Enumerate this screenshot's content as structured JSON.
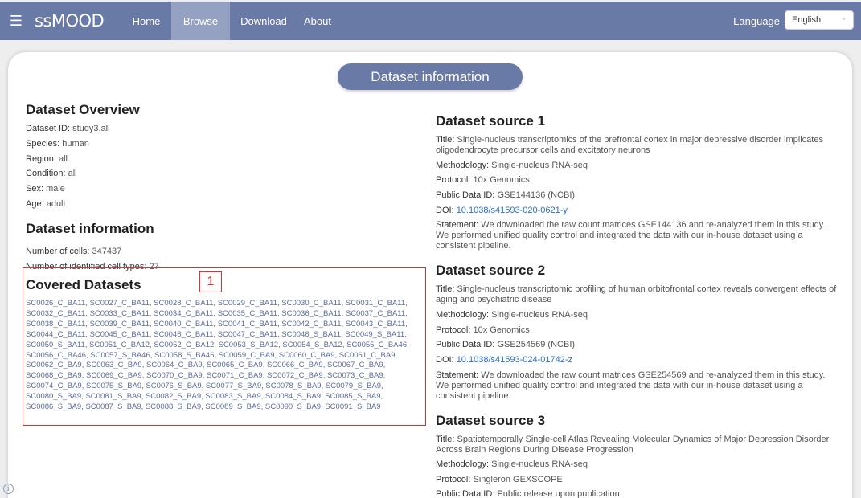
{
  "navbar": {
    "menu_icon": "hamburger-menu-icon",
    "logo": "ssMOOD",
    "items": [
      {
        "label": "Home",
        "active": false
      },
      {
        "label": "Browse",
        "active": true
      },
      {
        "label": "Download",
        "active": false
      },
      {
        "label": "About",
        "active": false
      }
    ],
    "language_label": "Language",
    "language_selected": "English"
  },
  "header": {
    "title": "Dataset information"
  },
  "overview": {
    "title": "Dataset Overview",
    "fields": [
      {
        "label": "Dataset ID:",
        "value": "study3.all"
      },
      {
        "label": "Species:",
        "value": "human"
      },
      {
        "label": "Region:",
        "value": "all"
      },
      {
        "label": "Condition:",
        "value": "all"
      },
      {
        "label": "Sex:",
        "value": "male"
      },
      {
        "label": "Age:",
        "value": "adult"
      }
    ]
  },
  "info": {
    "title": "Dataset information",
    "fields": [
      {
        "label": "Number of cells:",
        "value": "347437"
      },
      {
        "label": "Number of identified cell types:",
        "value": "27"
      }
    ]
  },
  "covered": {
    "title": "Covered Datasets",
    "annotation_tag": "1",
    "lines": [
      "SC0026_C_BA11, SC0027_C_BA11, SC0028_C_BA11, SC0029_C_BA11, SC0030_C_BA11, SC0031_C_BA11,",
      "SC0032_C_BA11, SC0033_C_BA11, SC0034_C_BA11, SC0035_C_BA11, SC0036_C_BA11, SC0037_C_BA11,",
      "SC0038_C_BA11, SC0039_C_BA11, SC0040_C_BA11, SC0041_C_BA11, SC0042_C_BA11, SC0043_C_BA11,",
      "SC0044_C_BA11, SC0045_C_BA11, SC0046_C_BA11, SC0047_C_BA11, SC0048_S_BA11, SC0049_S_BA11,",
      "SC0050_S_BA11, SC0051_C_BA12, SC0052_C_BA12, SC0053_S_BA12, SC0054_S_BA12, SC0055_C_BA46,",
      "SC0056_C_BA46, SC0057_S_BA46, SC0058_S_BA46, SC0059_C_BA9, SC0060_C_BA9, SC0061_C_BA9,",
      "SC0062_C_BA9, SC0063_C_BA9, SC0064_C_BA9, SC0065_C_BA9, SC0066_C_BA9, SC0067_C_BA9,",
      "SC0068_C_BA9, SC0069_C_BA9, SC0070_C_BA9, SC0071_C_BA9, SC0072_C_BA9, SC0073_C_BA9,",
      "SC0074_C_BA9, SC0075_S_BA9, SC0076_S_BA9, SC0077_S_BA9, SC0078_S_BA9, SC0079_S_BA9,",
      "SC0080_S_BA9, SC0081_S_BA9, SC0082_S_BA9, SC0083_S_BA9, SC0084_S_BA9, SC0085_S_BA9,",
      "SC0086_S_BA9, SC0087_S_BA9, SC0088_S_BA9, SC0089_S_BA9, SC0090_S_BA9, SC0091_S_BA9"
    ]
  },
  "sources": [
    {
      "title": "Dataset source 1",
      "title_label": "Title:",
      "title_value": "Single-nucleus transcriptomics of the prefrontal cortex in major depressive disorder implicates oligodendrocyte precursor cells and excitatory neurons",
      "method_label": "Methodology:",
      "method_value": "Single-nucleus RNA-seq",
      "protocol_label": "Protocol:",
      "protocol_value": "10x Genomics",
      "pid_label": "Public Data ID:",
      "pid_value": "GSE144136 (NCBI)",
      "doi_label": "DOI:",
      "doi_value": "10.1038/s41593-020-0621-y",
      "statement_label": "Statement:",
      "statement_value": "We downloaded the raw count matrices GSE144136 and re-analyzed them in this study. We performed unified quality control and integrated the data with our in-house dataset using a consistent pipeline."
    },
    {
      "title": "Dataset source 2",
      "title_label": "Title:",
      "title_value": "Single-nucleus transcriptomic profiling of human orbitofrontal cortex reveals convergent effects of aging and psychiatric disease",
      "method_label": "Methodology:",
      "method_value": "Single-nucleus RNA-seq",
      "protocol_label": "Protocol:",
      "protocol_value": "10x Genomics",
      "pid_label": "Public Data ID:",
      "pid_value": "GSE254569 (NCBI)",
      "doi_label": "DOI:",
      "doi_value": "10.1038/s41593-024-01742-z",
      "statement_label": "Statement:",
      "statement_value": "We downloaded the raw count matrices GSE254569 and re-analyzed them in this study. We performed unified quality control and integrated the data with our in-house dataset using a consistent pipeline."
    },
    {
      "title": "Dataset source 3",
      "title_label": "Title:",
      "title_value": "Spatiotemporally Single-cell Atlas Revealing Molecular Dynamics of Major Depression Disorder Across Brain Regions During Disease Progression",
      "method_label": "Methodology:",
      "method_value": "Single-nucleus RNA-seq",
      "protocol_label": "Protocol:",
      "protocol_value": "Singleron GEXSCOPE",
      "pid_label": "Public Data ID:",
      "pid_value": "Public release upon publication"
    }
  ],
  "footer": {
    "info_icon": "info-icon"
  }
}
